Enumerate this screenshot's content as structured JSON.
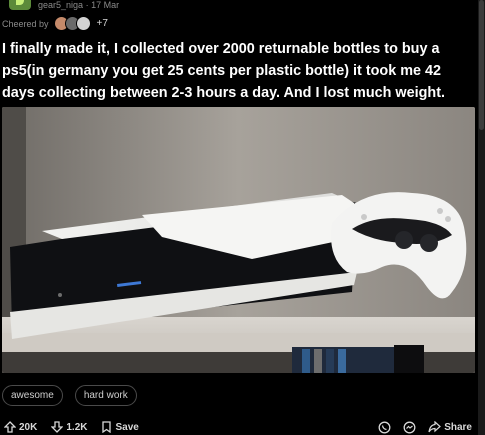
{
  "post": {
    "author": "gear5_niga",
    "dot": "·",
    "date": "17 Mar",
    "cheered_label": "Cheered by",
    "cheered_more": "+7",
    "title": "I finally made it, I collected over 2000 returnable bottles to buy a ps5(in germany you get 25 cents per plastic bottle) it took me 42 days collecting between 2-3 hours a day. And I lost much weight.",
    "tags": [
      "awesome",
      "hard work"
    ]
  },
  "actions": {
    "upvote_count": "20K",
    "downvote_count": "1.2K",
    "save_label": "Save",
    "share_label": "Share"
  },
  "colors": {
    "background": "#000000",
    "text_primary": "#ffffff",
    "text_muted": "#8a8a8a",
    "tag_border": "#4a4a4a"
  },
  "icons": {
    "upvote": "arrow-up-icon",
    "downvote": "arrow-down-icon",
    "save": "bookmark-icon",
    "whatsapp": "whatsapp-icon",
    "messenger": "messenger-icon",
    "share": "share-icon"
  }
}
